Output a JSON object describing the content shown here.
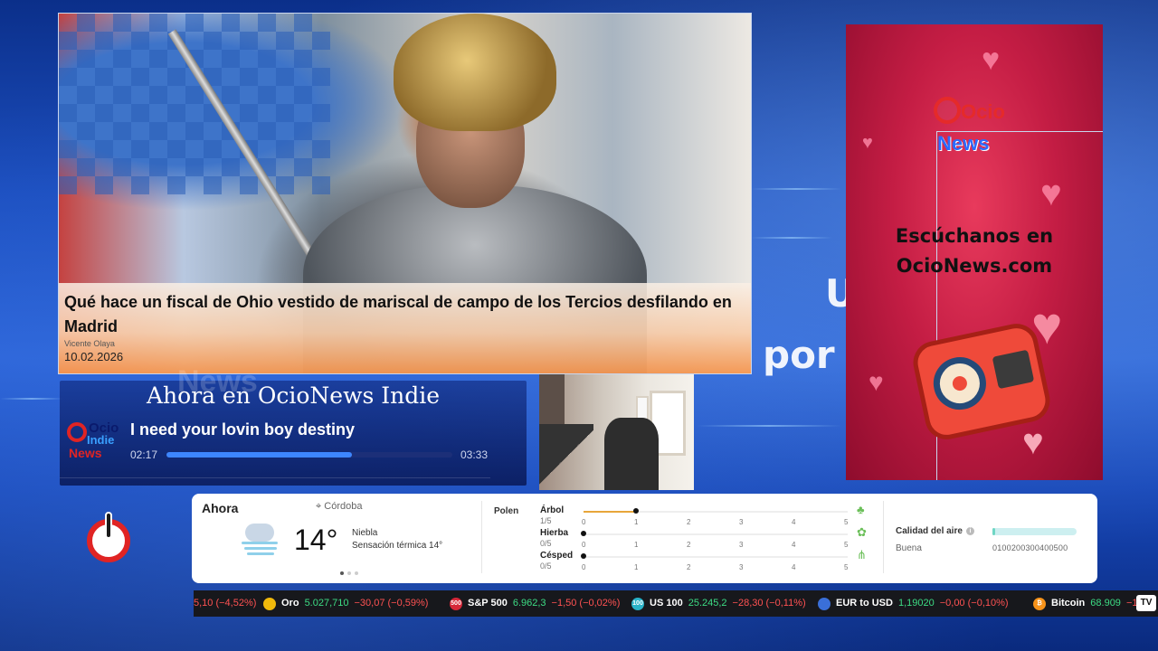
{
  "background": {
    "word_left": "News",
    "word_right_1": "U",
    "word_right_2": "por"
  },
  "news": {
    "headline": "Qué hace un fiscal de Ohio vestido de mariscal de campo de los Tercios desfilando en Madrid",
    "author": "Vicente Olaya",
    "date": "10.02.2026"
  },
  "player": {
    "title": "Ahora en OcioNews Indie",
    "logo": {
      "line1": "Ocio",
      "line2": "Indie",
      "line3": "News"
    },
    "song": "I need your lovin boy destiny",
    "elapsed": "02:17",
    "duration": "03:33",
    "progress": 0.65
  },
  "ad": {
    "logo_top": "Ocio",
    "logo_bottom": "News",
    "line1": "Escúchanos en",
    "line2": "OcioNews.com",
    "colors": {
      "bg": "#c41d44",
      "logo_red": "#e52a2a",
      "logo_blue": "#2b6bff"
    }
  },
  "weather": {
    "now_label": "Ahora",
    "location": "Córdoba",
    "temperature": "14°",
    "condition": "Niebla",
    "feels_like": "Sensación térmica 14°",
    "icon": "fog-icon",
    "pollen": {
      "title": "Polen",
      "ticks": [
        "0",
        "1",
        "2",
        "3",
        "4",
        "5"
      ],
      "items": [
        {
          "name": "Árbol",
          "value": "1/5",
          "level": 1,
          "icon": "tree-icon"
        },
        {
          "name": "Hierba",
          "value": "0/5",
          "level": 0,
          "icon": "herb-icon"
        },
        {
          "name": "Césped",
          "value": "0/5",
          "level": 0,
          "icon": "grass-icon"
        }
      ]
    },
    "air": {
      "title": "Calidad del aire",
      "value": "Buena",
      "scale": "0100200300400500",
      "info_icon": "info-icon"
    }
  },
  "ticker": [
    {
      "name": "",
      "price": "",
      "change": "5,10 (−4,52%)",
      "badge": "",
      "color": ""
    },
    {
      "name": "Oro",
      "price": "5.027,710",
      "change": "−30,07 (−0,59%)",
      "badge": "",
      "color": "#f0b90b"
    },
    {
      "name": "S&P 500",
      "price": "6.962,3",
      "change": "−1,50 (−0,02%)",
      "badge": "500",
      "color": "#d62839"
    },
    {
      "name": "US 100",
      "price": "25.245,2",
      "change": "−28,30 (−0,11%)",
      "badge": "100",
      "color": "#2ab3c8"
    },
    {
      "name": "EUR to USD",
      "price": "1,19020",
      "change": "−0,00 (−0,10%)",
      "badge": "",
      "color": "#3a6fd8"
    },
    {
      "name": "Bitcoin",
      "price": "68.909",
      "change": "−1",
      "badge": "₿",
      "color": "#f7931a"
    }
  ],
  "ticker_brand": "TV"
}
